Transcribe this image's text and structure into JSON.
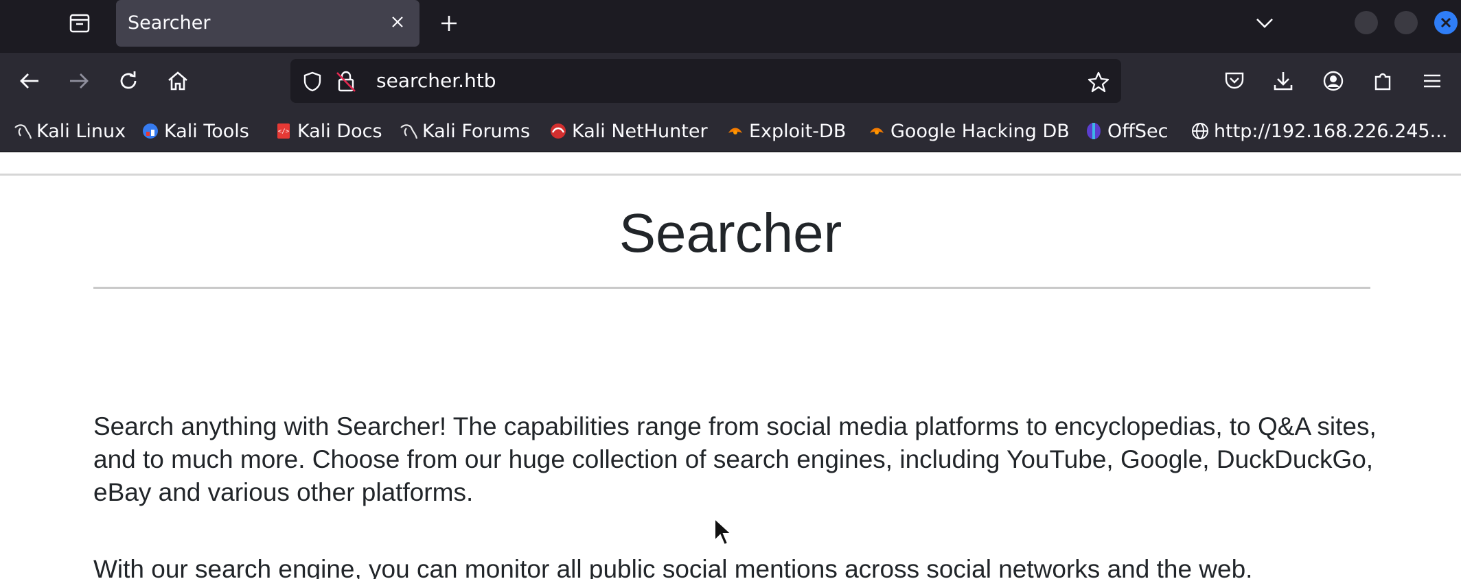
{
  "browser": {
    "tab": {
      "title": "Searcher",
      "active": true
    },
    "url": "searcher.htb",
    "bookmarks": [
      {
        "label": "Kali Linux",
        "icon": "kali-dragon-icon"
      },
      {
        "label": "Kali Tools",
        "icon": "kali-tools-icon"
      },
      {
        "label": "Kali Docs",
        "icon": "kali-docs-icon"
      },
      {
        "label": "Kali Forums",
        "icon": "kali-dragon-icon"
      },
      {
        "label": "Kali NetHunter",
        "icon": "nethunter-icon"
      },
      {
        "label": "Exploit-DB",
        "icon": "exploit-db-icon"
      },
      {
        "label": "Google Hacking DB",
        "icon": "exploit-db-icon"
      },
      {
        "label": "OffSec",
        "icon": "offsec-icon"
      },
      {
        "label": "http://192.168.226.245...",
        "icon": "globe-icon"
      }
    ],
    "colors": {
      "tabstrip": "#1c1b22",
      "toolbar": "#2b2a33",
      "accent": "#2f7ef7"
    }
  },
  "page": {
    "title": "Searcher",
    "paragraphs": [
      "Search anything with Searcher! The capabilities range from social media platforms to encyclopedias, to Q&A sites, and to much more. Choose from our huge collection of search engines, including YouTube, Google, DuckDuckGo, eBay and various other platforms.",
      "With our search engine, you can monitor all public social mentions across social networks and the web."
    ]
  }
}
